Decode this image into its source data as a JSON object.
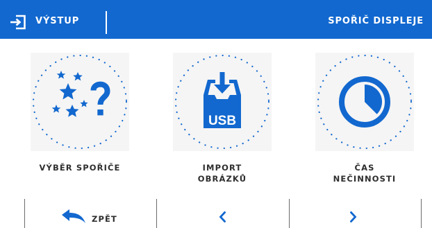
{
  "header": {
    "exit_label": "VÝSTUP",
    "title": "SPOŘIČ DISPLEJE"
  },
  "options": [
    {
      "label": "VÝBĚR SPOŘIČE",
      "icon": "stars-question-icon"
    },
    {
      "label": "IMPORT\nOBRÁZKŮ",
      "icon": "usb-import-icon",
      "icon_text": "USB"
    },
    {
      "label": "ČAS\nNEČINNOSTI",
      "icon": "clock-icon"
    }
  ],
  "nav": {
    "back_label": "ZPĚT",
    "prev_icon": "chevron-left-icon",
    "next_icon": "chevron-right-icon"
  },
  "colors": {
    "accent": "#1268cf",
    "header_text": "#ffffff",
    "label_text": "#2e2e2e",
    "tile_background": "#f5f5f5"
  }
}
